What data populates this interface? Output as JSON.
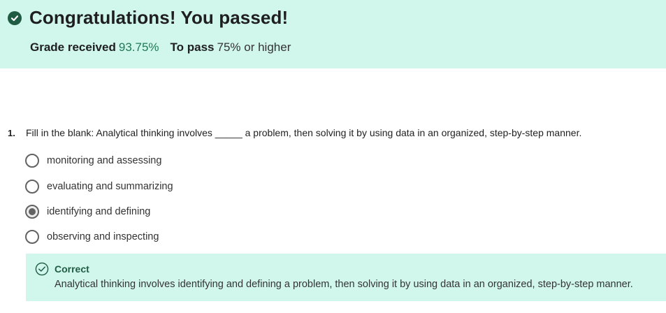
{
  "banner": {
    "title": "Congratulations! You passed!",
    "grade_label": "Grade received",
    "grade_value": "93.75%",
    "pass_label": "To pass",
    "pass_value": "75% or higher"
  },
  "question": {
    "number": "1.",
    "text": "Fill in the blank: Analytical thinking involves _____ a problem, then solving it by using data in an organized, step-by-step manner.",
    "options": [
      {
        "label": "monitoring and assessing",
        "selected": false
      },
      {
        "label": "evaluating and summarizing",
        "selected": false
      },
      {
        "label": "identifying and defining",
        "selected": true
      },
      {
        "label": "observing and inspecting",
        "selected": false
      }
    ]
  },
  "feedback": {
    "status": "Correct",
    "explanation": "Analytical thinking involves identifying and defining a problem, then solving it by using data in an organized, step-by-step manner."
  },
  "colors": {
    "banner_bg": "#d1f7ec",
    "success_dark": "#1f5c43",
    "grade_green": "#1f7a55"
  },
  "icons": {
    "banner": "check-circle-filled-icon",
    "feedback": "check-circle-outline-icon"
  }
}
